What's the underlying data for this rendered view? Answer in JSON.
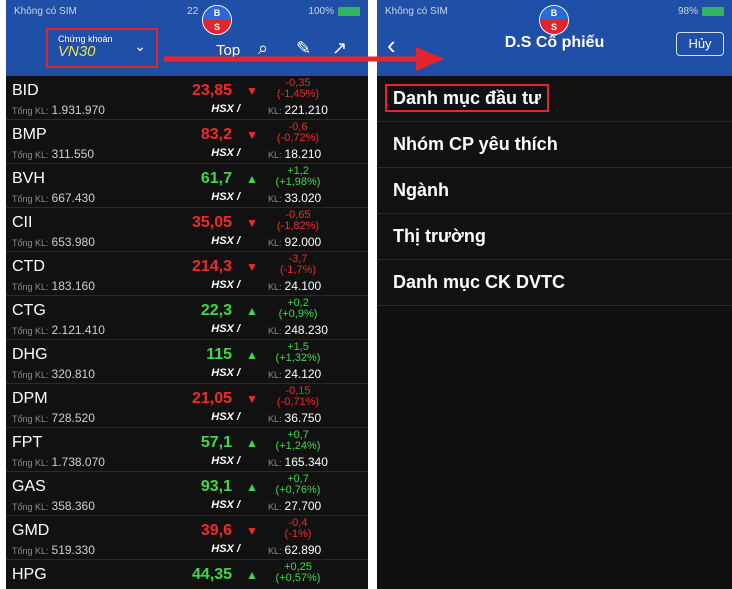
{
  "left_status": {
    "carrier": "Không có SIM",
    "time": "22",
    "battery": "100%"
  },
  "right_status": {
    "carrier": "Không có SIM",
    "battery": "98%"
  },
  "logo": {
    "top": "B",
    "bottom": "S"
  },
  "left_nav": {
    "selector_label": "Chứng khoán",
    "selector_value": "VN30",
    "top_label": "Top"
  },
  "right_nav": {
    "title": "D.S Cổ phiếu",
    "cancel": "Hủy"
  },
  "labels": {
    "total_vol": "Tổng KL:",
    "kl": "KL:"
  },
  "stocks": [
    {
      "code": "BID",
      "total_vol": "1.931.970",
      "price": "23,85",
      "exchange": "HSX /",
      "trend": "down",
      "change": "-0,35",
      "change_pct": "(-1,45%)",
      "kl": "221.210"
    },
    {
      "code": "BMP",
      "total_vol": "311.550",
      "price": "83,2",
      "exchange": "HSX /",
      "trend": "down",
      "change": "-0,6",
      "change_pct": "(-0,72%)",
      "kl": "18.210"
    },
    {
      "code": "BVH",
      "total_vol": "667.430",
      "price": "61,7",
      "exchange": "HSX /",
      "trend": "up",
      "change": "+1,2",
      "change_pct": "(+1,98%)",
      "kl": "33.020"
    },
    {
      "code": "CII",
      "total_vol": "653.980",
      "price": "35,05",
      "exchange": "HSX /",
      "trend": "down",
      "change": "-0,65",
      "change_pct": "(-1,82%)",
      "kl": "92.000"
    },
    {
      "code": "CTD",
      "total_vol": "183.160",
      "price": "214,3",
      "exchange": "HSX /",
      "trend": "down",
      "change": "-3,7",
      "change_pct": "(-1,7%)",
      "kl": "24.100"
    },
    {
      "code": "CTG",
      "total_vol": "2.121.410",
      "price": "22,3",
      "exchange": "HSX /",
      "trend": "up",
      "change": "+0,2",
      "change_pct": "(+0,9%)",
      "kl": "248.230"
    },
    {
      "code": "DHG",
      "total_vol": "320.810",
      "price": "115",
      "exchange": "HSX /",
      "trend": "up",
      "change": "+1,5",
      "change_pct": "(+1,32%)",
      "kl": "24.120"
    },
    {
      "code": "DPM",
      "total_vol": "728.520",
      "price": "21,05",
      "exchange": "HSX /",
      "trend": "down",
      "change": "-0,15",
      "change_pct": "(-0,71%)",
      "kl": "36.750"
    },
    {
      "code": "FPT",
      "total_vol": "1.738.070",
      "price": "57,1",
      "exchange": "HSX /",
      "trend": "up",
      "change": "+0,7",
      "change_pct": "(+1,24%)",
      "kl": "165.340"
    },
    {
      "code": "GAS",
      "total_vol": "358.360",
      "price": "93,1",
      "exchange": "HSX /",
      "trend": "up",
      "change": "+0,7",
      "change_pct": "(+0,76%)",
      "kl": "27.700"
    },
    {
      "code": "GMD",
      "total_vol": "519.330",
      "price": "39,6",
      "exchange": "HSX /",
      "trend": "down",
      "change": "-0,4",
      "change_pct": "(-1%)",
      "kl": "62.890"
    },
    {
      "code": "HPG",
      "total_vol": "",
      "price": "44,35",
      "exchange": "",
      "trend": "up",
      "change": "+0,25",
      "change_pct": "(+0,57%)",
      "kl": ""
    }
  ],
  "menu": [
    {
      "label": "Danh mục đầu tư",
      "highlighted": true
    },
    {
      "label": "Nhóm CP yêu thích",
      "highlighted": false
    },
    {
      "label": "Ngành",
      "highlighted": false
    },
    {
      "label": "Thị trường",
      "highlighted": false
    },
    {
      "label": "Danh mục CK DVTC",
      "highlighted": false
    }
  ],
  "colors": {
    "nav_blue": "#1f4fa6",
    "up_green": "#3fd84a",
    "down_red": "#ef2a2a",
    "highlight_red": "#e3262c",
    "selector_yellow": "#f0e04a"
  },
  "icons": {
    "left_nav": [
      "search-icon",
      "pencil-icon",
      "expand-icon"
    ],
    "right_nav": [
      "back-chevron-icon"
    ]
  }
}
